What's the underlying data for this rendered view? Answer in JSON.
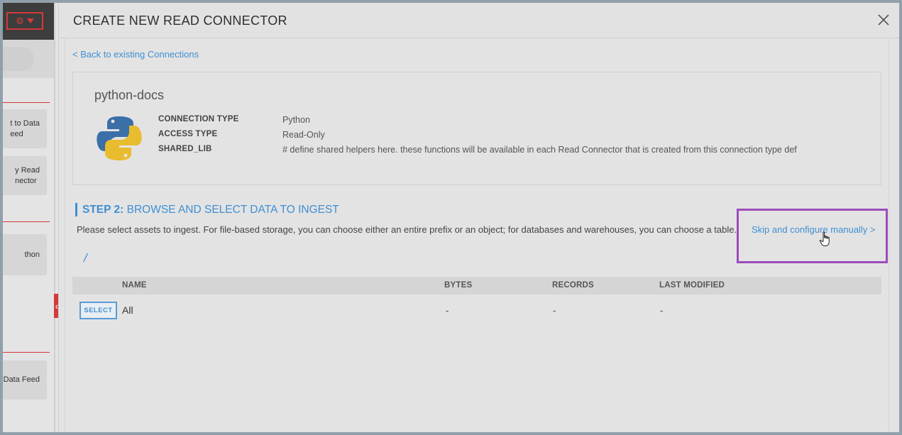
{
  "sidebar": {
    "cards": [
      {
        "label": "t to Data\need"
      },
      {
        "label": "y Read\nnector"
      },
      {
        "label": "thon"
      },
      {
        "label": "Data Feed"
      }
    ]
  },
  "modal": {
    "title": "CREATE NEW READ CONNECTOR",
    "back_link": "< Back to existing Connections",
    "connection": {
      "name": "python-docs",
      "icon": "python-logo-icon",
      "meta": [
        {
          "key": "CONNECTION TYPE",
          "value": "Python"
        },
        {
          "key": "ACCESS TYPE",
          "value": "Read-Only"
        },
        {
          "key": "SHARED_LIB",
          "value": "# define shared helpers here. these functions will be available in each Read Connector that is created from this connection type def"
        }
      ]
    },
    "step": {
      "number_label": "STEP 2:",
      "title": "BROWSE AND SELECT DATA TO INGEST",
      "description": "Please select assets to ingest. For file-based storage, you can choose either an entire prefix or an object; for databases and warehouses, you can choose a table.",
      "skip_link": "Skip and configure manually >"
    },
    "path": "/",
    "table": {
      "columns": [
        "NAME",
        "BYTES",
        "RECORDS",
        "LAST MODIFIED"
      ],
      "rows": [
        {
          "select_label": "SELECT",
          "name": "All",
          "bytes": "-",
          "records": "-",
          "last_modified": "-"
        }
      ]
    }
  },
  "colors": {
    "accent": "#3f8fd3",
    "highlight": "#9b4dbb",
    "sidebar_alert": "#d33a3a"
  }
}
